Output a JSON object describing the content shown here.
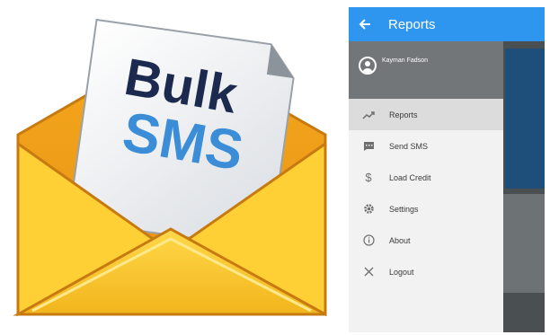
{
  "logo": {
    "line1": "Bulk",
    "line2": "SMS"
  },
  "app": {
    "header_title": "Reports",
    "user_name": "Kayman Fadson",
    "menu": [
      {
        "label": "Reports",
        "icon": "trending-up-icon",
        "active": true
      },
      {
        "label": "Send SMS",
        "icon": "message-icon",
        "active": false
      },
      {
        "label": "Load Credit",
        "icon": "dollar-icon",
        "active": false
      },
      {
        "label": "Settings",
        "icon": "gear-icon",
        "active": false
      },
      {
        "label": "About",
        "icon": "info-icon",
        "active": false
      },
      {
        "label": "Logout",
        "icon": "close-icon",
        "active": false
      }
    ]
  },
  "colors": {
    "appbar": "#2f96ef",
    "drawer_header": "#727678",
    "envelope": "#f7c21e",
    "bulk_text": "#1b2a4e",
    "sms_text": "#3a8dd6"
  }
}
